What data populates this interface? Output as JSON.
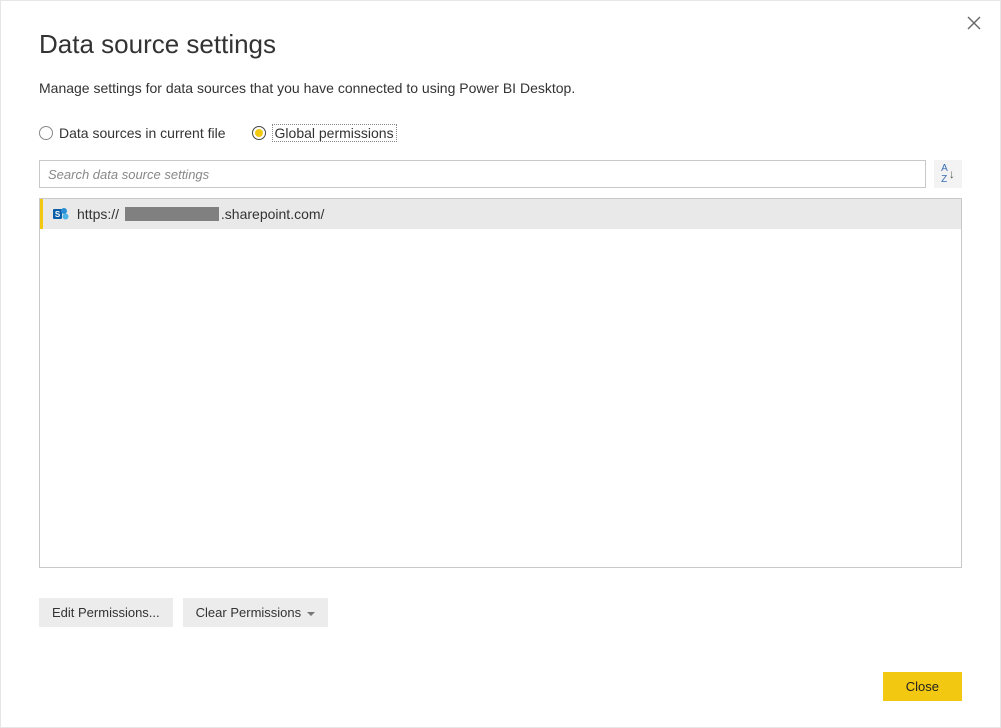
{
  "dialog": {
    "title": "Data source settings",
    "subtitle": "Manage settings for data sources that you have connected to using Power BI Desktop.",
    "close_title": "Close"
  },
  "scope": {
    "current_file": "Data sources in current file",
    "global": "Global permissions",
    "selected": "global"
  },
  "search": {
    "placeholder": "Search data source settings",
    "value": ""
  },
  "sources": [
    {
      "icon": "sharepoint",
      "url_prefix": "https:// ",
      "url_suffix": ".sharepoint.com/",
      "redacted": true,
      "selected": true
    }
  ],
  "actions": {
    "edit": "Edit Permissions...",
    "clear": "Clear Permissions"
  },
  "footer": {
    "close": "Close"
  }
}
